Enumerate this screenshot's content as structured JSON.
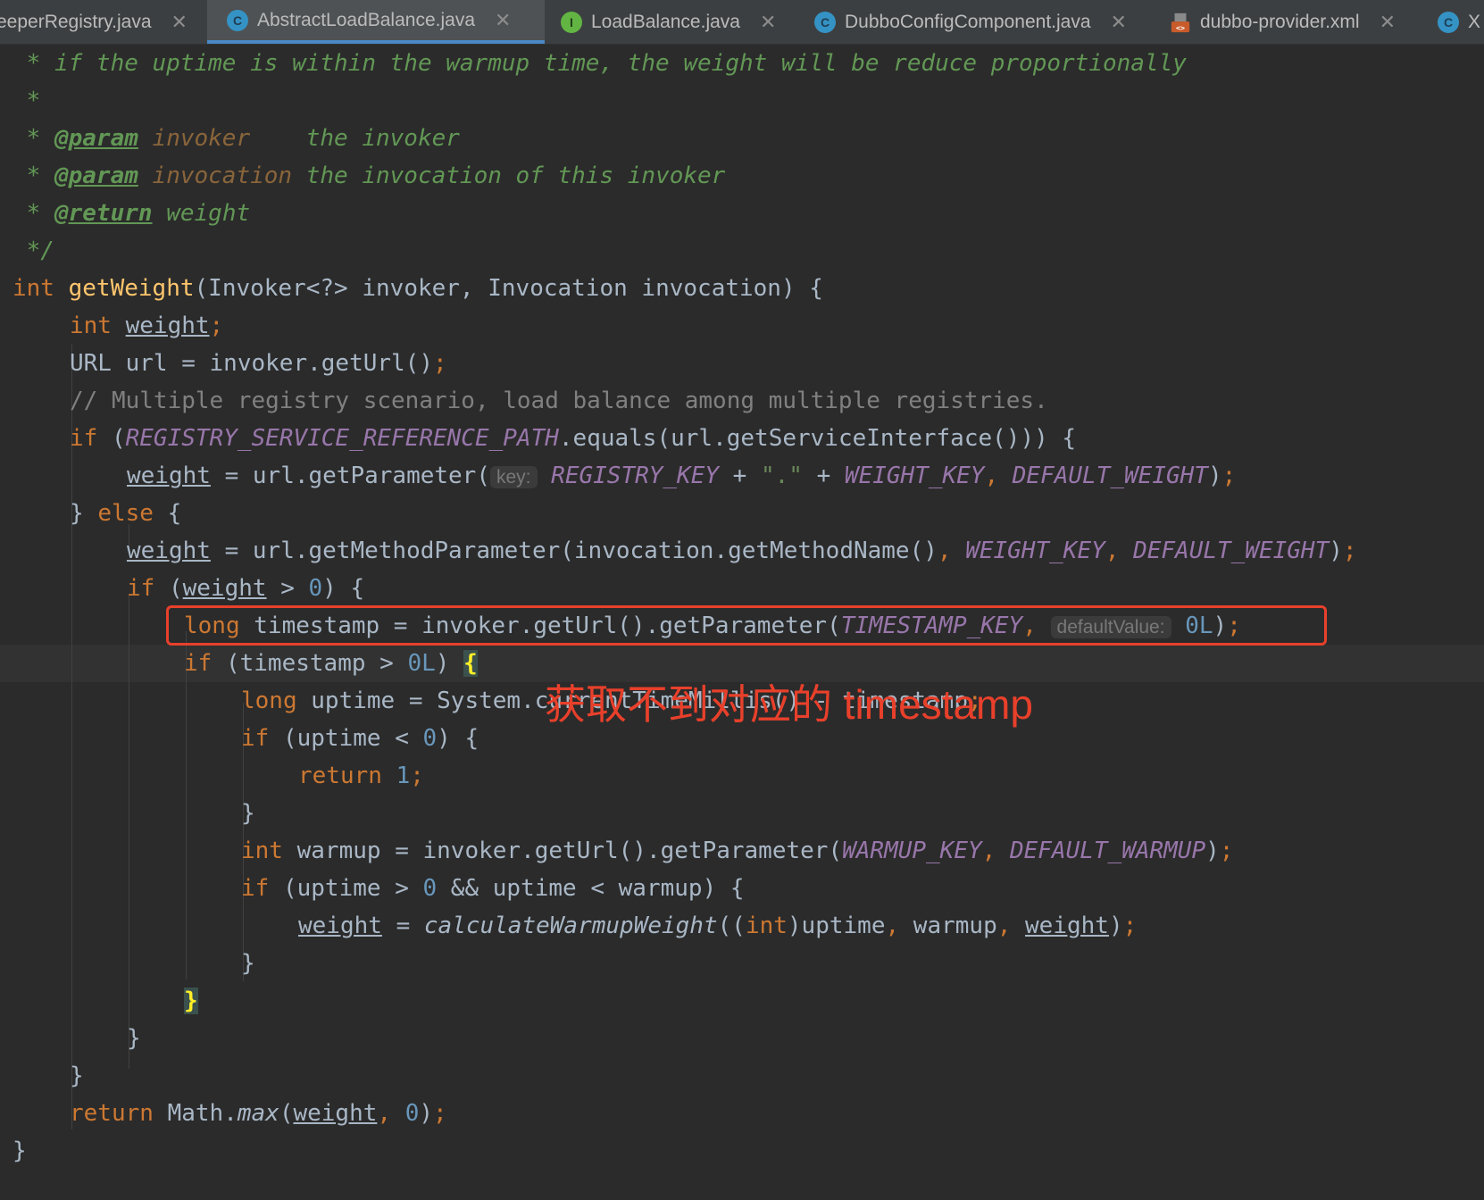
{
  "tabs": [
    {
      "label": "eeperRegistry.java",
      "icon": "java-class-icon",
      "active": false
    },
    {
      "label": "AbstractLoadBalance.java",
      "icon": "abstract-class-icon",
      "active": true
    },
    {
      "label": "LoadBalance.java",
      "icon": "interface-icon",
      "active": false
    },
    {
      "label": "DubboConfigComponent.java",
      "icon": "java-class-icon",
      "active": false
    },
    {
      "label": "dubbo-provider.xml",
      "icon": "xml-file-icon",
      "active": false
    },
    {
      "label": "X",
      "icon": "java-class-icon",
      "active": false
    }
  ],
  "tab_close_glyph": "✕",
  "code": {
    "l1": {
      "a": " * if the uptime is within the warmup time, the weight will be reduce proportionally"
    },
    "l2": {
      "a": " *"
    },
    "l3": {
      "a": " * ",
      "tag": "@param",
      "p": " invoker",
      "b": "    the invoker"
    },
    "l4": {
      "a": " * ",
      "tag": "@param",
      "p": " invocation",
      "b": " the invocation of this invoker"
    },
    "l5": {
      "a": " * ",
      "tag": "@return",
      "b": " weight"
    },
    "l6": {
      "a": " */"
    },
    "l7": {
      "kw": "int",
      "fn": "getWeight",
      "rest": "(Invoker<?> invoker, Invocation invocation) {"
    },
    "l8": {
      "kw": "int",
      "var": "weight",
      "semi": ";"
    },
    "l9": {
      "a": "URL url = invoker.getUrl()",
      "semi": ";"
    },
    "l10": {
      "cmt": "// Multiple registry scenario, load balance among multiple registries."
    },
    "l11": {
      "kw": "if",
      "a": " (",
      "cst": "REGISTRY_SERVICE_REFERENCE_PATH",
      "b": ".equals(url.getServiceInterface())) {"
    },
    "l12": {
      "var": "weight",
      "a": " = url.getParameter(",
      "hint": "key:",
      "c1": "REGISTRY_KEY",
      "b": " + ",
      "str": "\".\"",
      "c": " + ",
      "c2": "WEIGHT_KEY",
      "comma": ", ",
      "c3": "DEFAULT_WEIGHT",
      "d": ")",
      "semi": ";"
    },
    "l13": {
      "a": "} ",
      "kw": "else",
      "b": " {"
    },
    "l14": {
      "var": "weight",
      "a": " = url.getMethodParameter(invocation.getMethodName()",
      "comma1": ", ",
      "c1": "WEIGHT_KEY",
      "comma2": ", ",
      "c2": "DEFAULT_WEIGHT",
      "b": ")",
      "semi": ";"
    },
    "l15": {
      "kw": "if",
      "a": " (",
      "var": "weight",
      "b": " > ",
      "num": "0",
      "c": ") {"
    },
    "l16": {
      "kw": "long",
      "a": " timestamp = invoker.getUrl().getParameter(",
      "c1": "TIMESTAMP_KEY",
      "comma": ", ",
      "hint": "defaultValue:",
      "num": "0L",
      "b": ")",
      "semi": ";"
    },
    "l17": {
      "kw": "if",
      "a": " (timestamp > ",
      "num": "0L",
      "b": ") ",
      "brace": "{"
    },
    "l18": {
      "kw": "long",
      "a": " uptime = System.currentTimeMillis() - timestamp",
      "semi": ";"
    },
    "l19": {
      "kw": "if",
      "a": " (uptime < ",
      "num": "0",
      "b": ") {"
    },
    "l20": {
      "kw": "return",
      "num": " 1",
      "semi": ";"
    },
    "l21": {
      "a": "}"
    },
    "l22": {
      "kw": "int",
      "a": " warmup = invoker.getUrl().getParameter(",
      "c1": "WARMUP_KEY",
      "comma": ", ",
      "c2": "DEFAULT_WARMUP",
      "b": ")",
      "semi": ";"
    },
    "l23": {
      "kw": "if",
      "a": " (uptime > ",
      "num": "0",
      "b": " && uptime < warmup) {"
    },
    "l24": {
      "var": "weight",
      "a": " = ",
      "it": "calculateWarmupWeight",
      "b": "((",
      "kw": "int",
      "c": ")uptime",
      "comma1": ", ",
      "d": "warmup",
      "comma2": ", ",
      "var2": "weight",
      "e": ")",
      "semi": ";"
    },
    "l25": {
      "a": "}"
    },
    "l26": {
      "brace": "}"
    },
    "l27": {
      "a": "}"
    },
    "l28": {
      "a": "}"
    },
    "l29": {
      "kw": "return",
      "a": " Math.",
      "it": "max",
      "b": "(",
      "var": "weight",
      "comma": ", ",
      "num": "0",
      "c": ")",
      "semi": ";"
    },
    "l30": {
      "a": "}"
    }
  },
  "annotation": "获取不到对应的 timestamp",
  "colors": {
    "background": "#2b2b2b",
    "keyword": "#cc7832",
    "function": "#ffc66d",
    "constant": "#9876aa",
    "number": "#6897bb",
    "javadoc": "#629755",
    "comment": "#808080",
    "annotation_red": "#e8402b",
    "active_tab_underline": "#4a88c7"
  }
}
